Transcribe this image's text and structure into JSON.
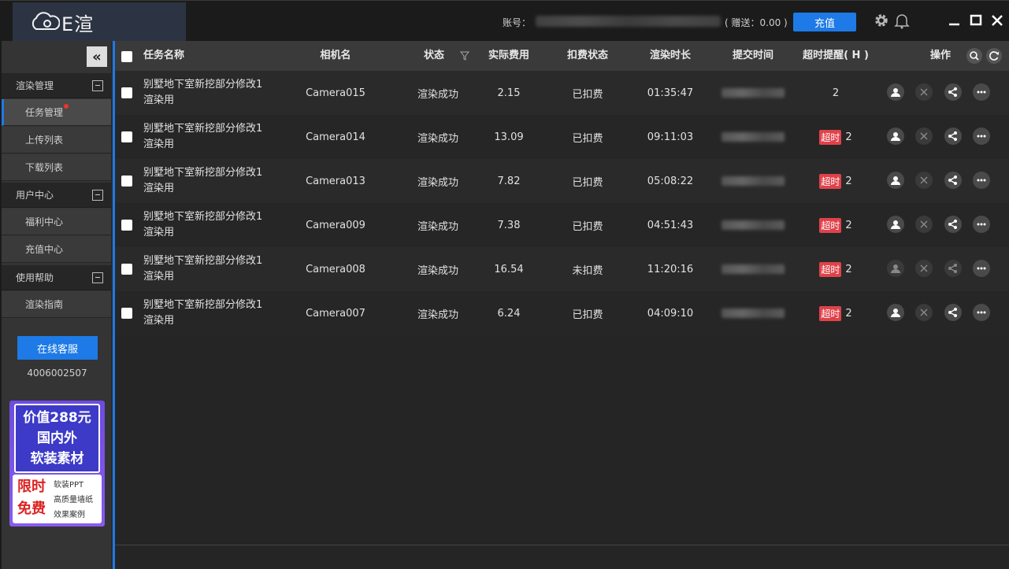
{
  "app": {
    "logo_text": "E渲"
  },
  "header": {
    "account_label": "账号：",
    "gift_text": "( 赠送：0.00 )",
    "recharge_label": "充值",
    "icons": [
      "gear-icon",
      "bell-icon",
      "minimize-icon",
      "maximize-icon",
      "close-icon"
    ]
  },
  "sidebar": {
    "groups": [
      {
        "label": "渲染管理",
        "items": [
          {
            "label": "任务管理",
            "active": true,
            "badge_dot": true
          },
          {
            "label": "上传列表"
          },
          {
            "label": "下载列表"
          }
        ]
      },
      {
        "label": "用户中心",
        "items": [
          {
            "label": "福利中心"
          },
          {
            "label": "充值中心"
          }
        ]
      },
      {
        "label": "使用帮助",
        "items": [
          {
            "label": "渲染指南"
          }
        ]
      }
    ],
    "service_label": "在线客服",
    "phone": "4006002507",
    "ad": {
      "line1": "价值288元",
      "line2": "国内外",
      "line3": "软装素材",
      "red1": "限时",
      "red2": "免费",
      "list": [
        "软装PPT",
        "高质量墙纸",
        "效果案例"
      ]
    }
  },
  "table": {
    "headers": {
      "name": "任务名称",
      "camera": "相机名",
      "status": "状态",
      "cost": "实际费用",
      "charge": "扣费状态",
      "duration": "渲染时长",
      "submit": "提交时间",
      "timeout": "超时提醒( H )",
      "ops": "操作"
    },
    "timeout_tag": "超时",
    "rows": [
      {
        "name": "别墅地下室新挖部分修改1渲染用",
        "camera": "Camera015",
        "status": "渲染成功",
        "cost": "2.15",
        "charge": "已扣费",
        "duration": "01:35:47",
        "timeout": "2",
        "overtime": false,
        "ops_dim": false
      },
      {
        "name": "别墅地下室新挖部分修改1渲染用",
        "camera": "Camera014",
        "status": "渲染成功",
        "cost": "13.09",
        "charge": "已扣费",
        "duration": "09:11:03",
        "timeout": "2",
        "overtime": true,
        "ops_dim": false
      },
      {
        "name": "别墅地下室新挖部分修改1渲染用",
        "camera": "Camera013",
        "status": "渲染成功",
        "cost": "7.82",
        "charge": "已扣费",
        "duration": "05:08:22",
        "timeout": "2",
        "overtime": true,
        "ops_dim": false
      },
      {
        "name": "别墅地下室新挖部分修改1渲染用",
        "camera": "Camera009",
        "status": "渲染成功",
        "cost": "7.38",
        "charge": "已扣费",
        "duration": "04:51:43",
        "timeout": "2",
        "overtime": true,
        "ops_dim": false
      },
      {
        "name": "别墅地下室新挖部分修改1渲染用",
        "camera": "Camera008",
        "status": "渲染成功",
        "cost": "16.54",
        "charge": "未扣费",
        "duration": "11:20:16",
        "timeout": "2",
        "overtime": true,
        "ops_dim": true
      },
      {
        "name": "别墅地下室新挖部分修改1渲染用",
        "camera": "Camera007",
        "status": "渲染成功",
        "cost": "6.24",
        "charge": "已扣费",
        "duration": "04:09:10",
        "timeout": "2",
        "overtime": true,
        "ops_dim": false
      }
    ]
  }
}
